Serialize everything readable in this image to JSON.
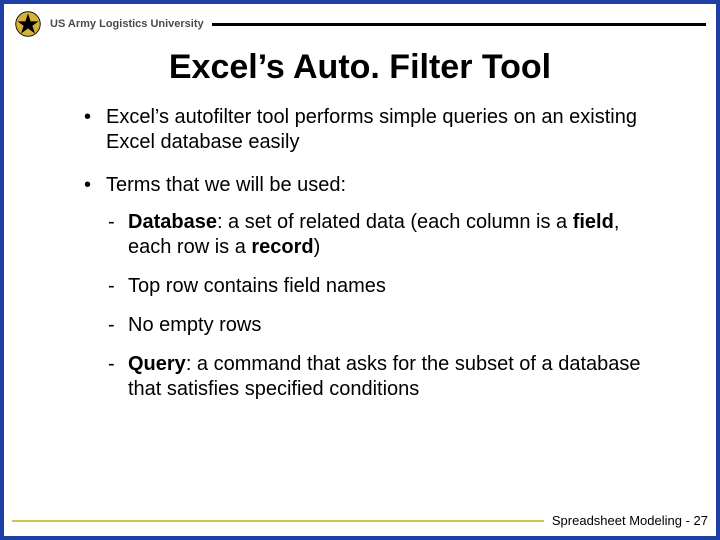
{
  "header": {
    "org": "US Army Logistics University"
  },
  "title": "Excel’s Auto. Filter Tool",
  "bullets": [
    {
      "text": "Excel’s autofilter tool performs simple queries on an existing Excel database easily"
    },
    {
      "text": "Terms that we will be used:",
      "sub": [
        {
          "html": "<span class='bold'>Database</span>:  a set of related data (each column is a <span class='bold'>field</span>, each row is a <span class='bold'>record</span>)"
        },
        {
          "html": "Top row contains field names"
        },
        {
          "html": "No empty rows"
        },
        {
          "html": "<span class='bold'>Query</span>:  a command that asks for the subset of a database that satisfies specified conditions"
        }
      ]
    }
  ],
  "footer": {
    "text": "Spreadsheet Modeling - 27"
  }
}
